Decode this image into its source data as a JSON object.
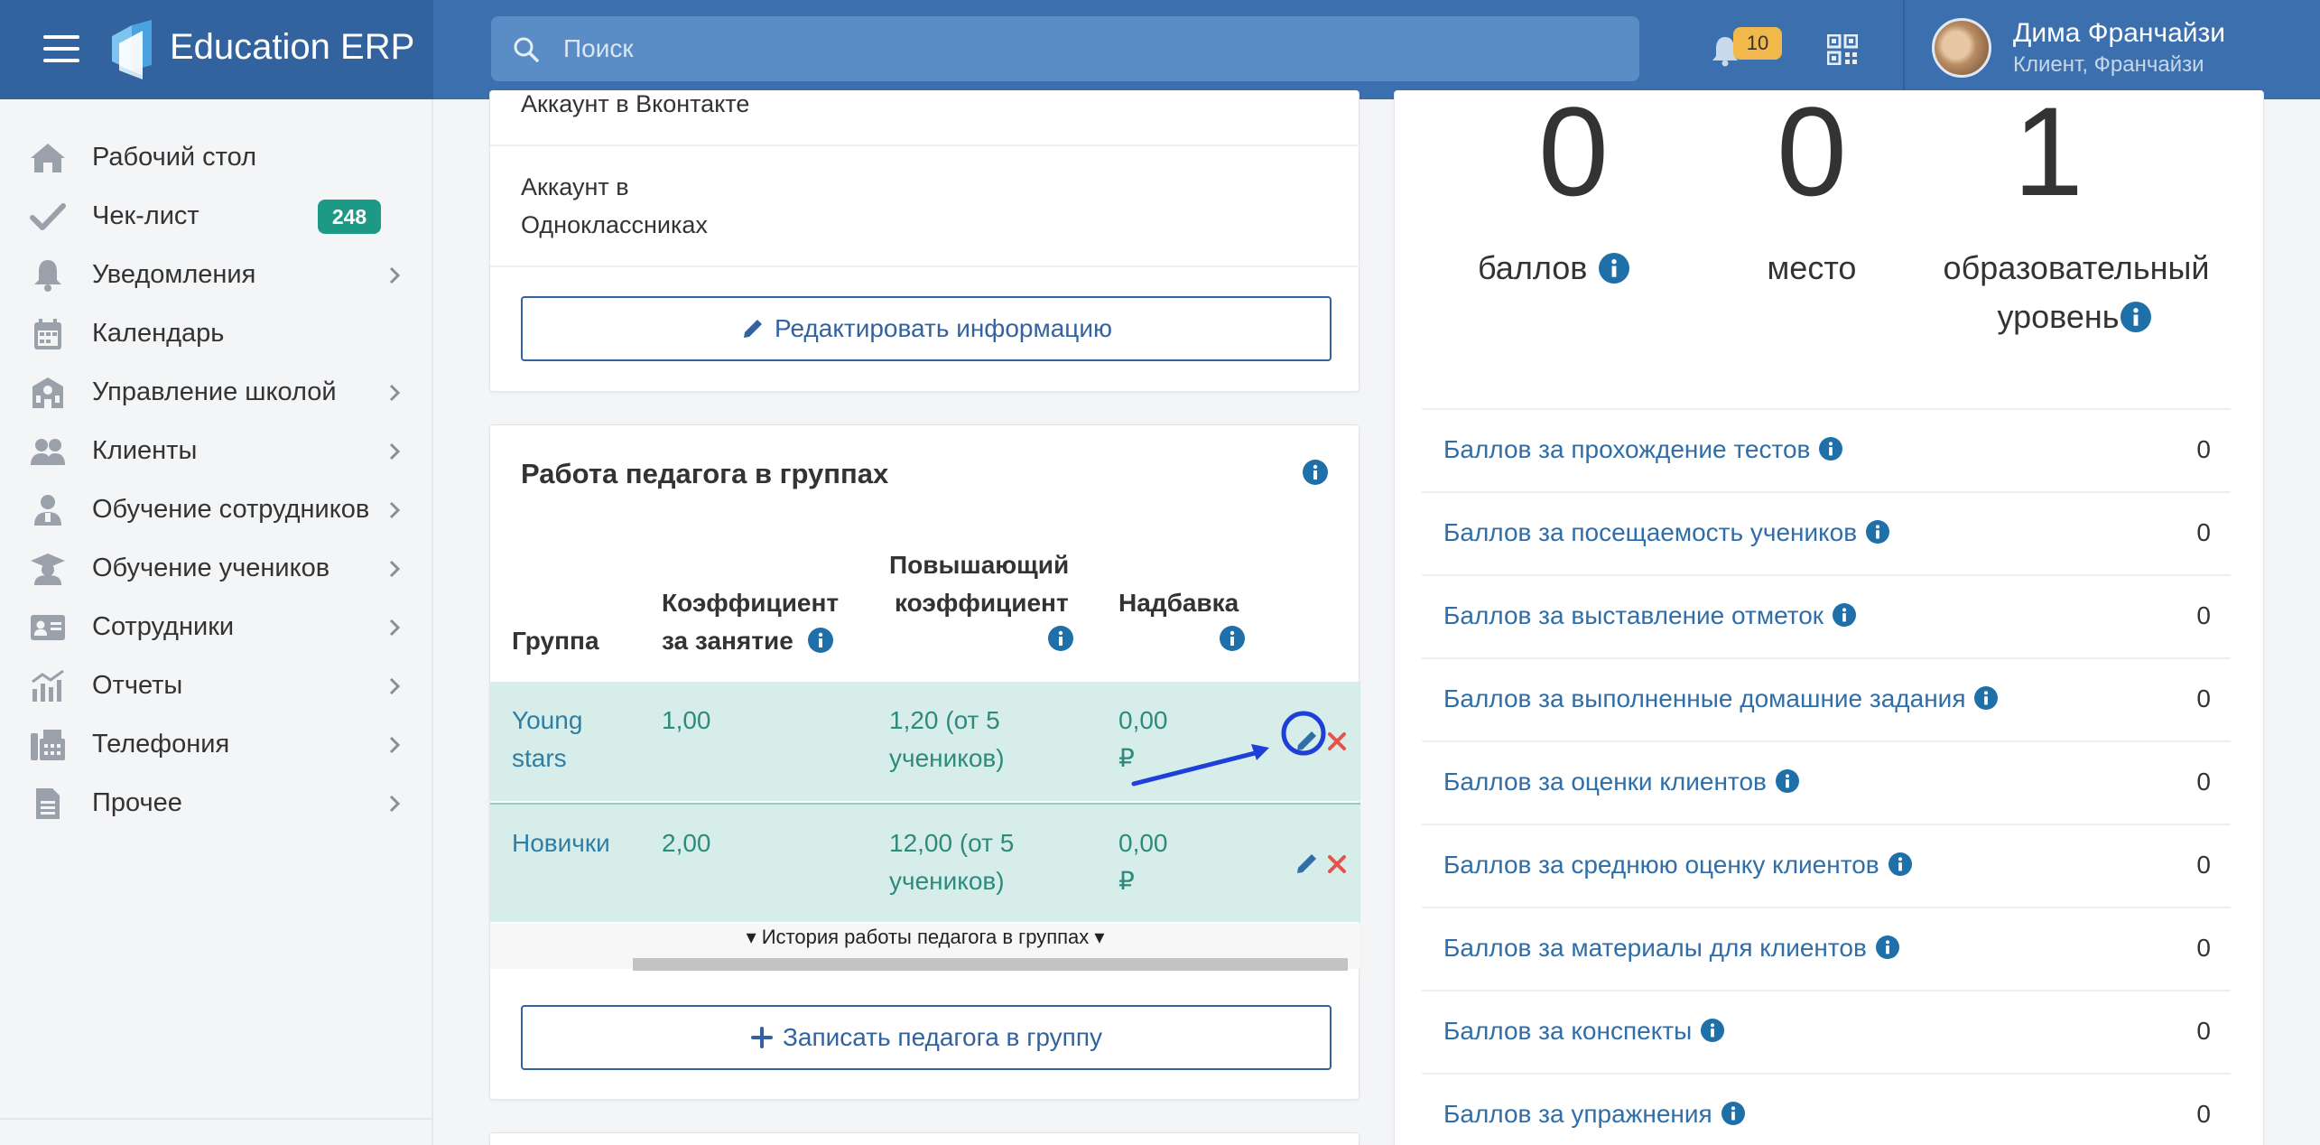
{
  "header": {
    "brand": "Education ERP",
    "search_placeholder": "Поиск",
    "notifications_count": "10",
    "user_name": "Дима Франчайзи",
    "user_role": "Клиент, Франчайзи"
  },
  "sidebar": {
    "items": [
      {
        "label": "Рабочий стол",
        "icon": "home-icon"
      },
      {
        "label": "Чек-лист",
        "icon": "check-icon",
        "badge": "248"
      },
      {
        "label": "Уведомления",
        "icon": "bell-icon"
      },
      {
        "label": "Календарь",
        "icon": "calendar-icon"
      },
      {
        "label": "Управление школой",
        "icon": "school-icon"
      },
      {
        "label": "Клиенты",
        "icon": "users-icon"
      },
      {
        "label": "Обучение сотрудников",
        "icon": "employee-training-icon"
      },
      {
        "label": "Обучение учеников",
        "icon": "graduation-cap-icon"
      },
      {
        "label": "Сотрудники",
        "icon": "id-card-icon"
      },
      {
        "label": "Отчеты",
        "icon": "chart-icon"
      },
      {
        "label": "Телефония",
        "icon": "fax-icon"
      },
      {
        "label": "Прочее",
        "icon": "file-icon"
      }
    ]
  },
  "profile_card": {
    "vk_label": "Аккаунт в Вконтакте",
    "ok_label_line1": "Аккаунт в",
    "ok_label_line2": "Одноклассниках",
    "edit_button": "Редактировать информацию"
  },
  "groups_card": {
    "title": "Работа педагога в группах",
    "columns": {
      "group": "Группа",
      "coef_line1": "Коэффициент",
      "coef_line2": "за занятие",
      "boost_line1": "Повышающий",
      "boost_line2": "коэффициент",
      "bonus": "Надбавка"
    },
    "rows": [
      {
        "group_line1": "Young",
        "group_line2": "stars",
        "coef": "1,00",
        "boost_line1": "1,20 (от 5",
        "boost_line2": "учеников)",
        "bonus_line1": "0,00",
        "bonus_line2": "₽"
      },
      {
        "group_line1": "Новички",
        "group_line2": "",
        "coef": "2,00",
        "boost_line1": "12,00 (от 5",
        "boost_line2": "учеников)",
        "bonus_line1": "0,00",
        "bonus_line2": "₽"
      }
    ],
    "history_toggle": "▾ История работы педагога в группах ▾",
    "enroll_button": "Записать педагога в группу"
  },
  "rating_card": {
    "stats": [
      {
        "value": "0",
        "label": "баллов"
      },
      {
        "value": "0",
        "label": "место"
      },
      {
        "value": "1",
        "label_line1": "образовательный",
        "label_line2": "уровень"
      }
    ],
    "scores": [
      {
        "label": "Баллов за прохождение тестов",
        "value": "0"
      },
      {
        "label": "Баллов за посещаемость учеников",
        "value": "0"
      },
      {
        "label": "Баллов за выставление отметок",
        "value": "0"
      },
      {
        "label": "Баллов за выполненные домашние задания",
        "value": "0"
      },
      {
        "label": "Баллов за оценки клиентов",
        "value": "0"
      },
      {
        "label": "Баллов за среднюю оценку клиентов",
        "value": "0"
      },
      {
        "label": "Баллов за материалы для клиентов",
        "value": "0"
      },
      {
        "label": "Баллов за конспекты",
        "value": "0"
      },
      {
        "label": "Баллов за упражнения",
        "value": "0"
      }
    ]
  },
  "colors": {
    "header": "#3b6fae",
    "brand_bg": "#33639e",
    "teal_badge": "#1d9a86",
    "row_highlight": "#d6ede9",
    "link": "#2f6ea8",
    "info": "#1f6fa8",
    "delete": "#e5534b",
    "annotation": "#1e3fd8"
  }
}
